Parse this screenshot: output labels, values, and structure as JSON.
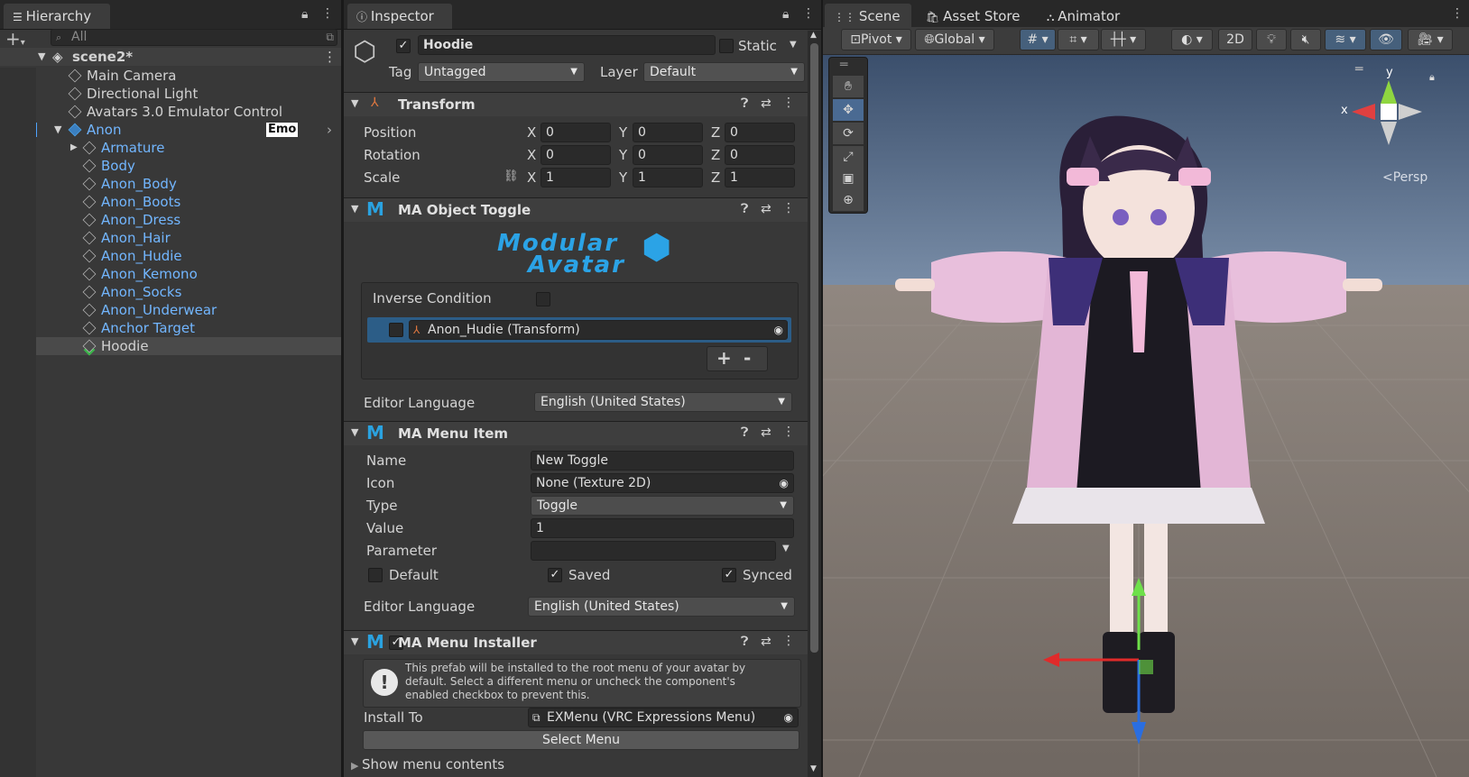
{
  "hierarchy": {
    "tab_label": "Hierarchy",
    "search_placeholder": "All",
    "scene_name": "scene2*",
    "items": [
      {
        "label": "Main Camera",
        "indent": 1,
        "blue": false
      },
      {
        "label": "Directional Light",
        "indent": 1,
        "blue": false
      },
      {
        "label": "Avatars 3.0 Emulator Control",
        "indent": 1,
        "blue": false
      },
      {
        "label": "Anon",
        "indent": 1,
        "blue": true
      },
      {
        "label": "Armature",
        "indent": 2,
        "blue": true
      },
      {
        "label": "Body",
        "indent": 2,
        "blue": true
      },
      {
        "label": "Anon_Body",
        "indent": 2,
        "blue": true
      },
      {
        "label": "Anon_Boots",
        "indent": 2,
        "blue": true
      },
      {
        "label": "Anon_Dress",
        "indent": 2,
        "blue": true
      },
      {
        "label": "Anon_Hair",
        "indent": 2,
        "blue": true
      },
      {
        "label": "Anon_Hudie",
        "indent": 2,
        "blue": true
      },
      {
        "label": "Anon_Kemono",
        "indent": 2,
        "blue": true
      },
      {
        "label": "Anon_Socks",
        "indent": 2,
        "blue": true
      },
      {
        "label": "Anon_Underwear",
        "indent": 2,
        "blue": true
      },
      {
        "label": "Anchor Target",
        "indent": 2,
        "blue": true
      },
      {
        "label": "Hoodie",
        "indent": 2,
        "blue": false
      }
    ],
    "anon_badge": "Emo"
  },
  "inspector": {
    "tab_label": "Inspector",
    "object_name": "Hoodie",
    "static_label": "Static",
    "tag_label": "Tag",
    "tag_value": "Untagged",
    "layer_label": "Layer",
    "layer_value": "Default",
    "transform": {
      "title": "Transform",
      "position_label": "Position",
      "rotation_label": "Rotation",
      "scale_label": "Scale",
      "axis_x": "X",
      "axis_y": "Y",
      "axis_z": "Z",
      "position": [
        "0",
        "0",
        "0"
      ],
      "rotation": [
        "0",
        "0",
        "0"
      ],
      "scale": [
        "1",
        "1",
        "1"
      ]
    },
    "object_toggle": {
      "title": "MA Object Toggle",
      "logo_line1": "Modular",
      "logo_line2": "Avatar",
      "inverse_label": "Inverse Condition",
      "entry": "Anon_Hudie (Transform)",
      "plus": "+",
      "minus": "-",
      "lang_label": "Editor Language",
      "lang_value": "English (United States)"
    },
    "menu_item": {
      "title": "MA Menu Item",
      "name_label": "Name",
      "name_value": "New Toggle",
      "icon_label": "Icon",
      "icon_value": "None (Texture 2D)",
      "type_label": "Type",
      "type_value": "Toggle",
      "value_label": "Value",
      "value_value": "1",
      "param_label": "Parameter",
      "param_value": "",
      "default_label": "Default",
      "saved_label": "Saved",
      "synced_label": "Synced",
      "lang_label": "Editor Language",
      "lang_value": "English (United States)"
    },
    "menu_installer": {
      "title": "MA Menu Installer",
      "info": "This prefab will be installed to the root menu of your avatar by default. Select a different menu or uncheck the component's enabled checkbox to prevent this.",
      "install_label": "Install To",
      "install_value": "EXMenu (VRC Expressions Menu)",
      "select_button": "Select Menu",
      "show_contents": "Show menu contents"
    }
  },
  "scene": {
    "tabs": [
      "Scene",
      "Asset Store",
      "Animator"
    ],
    "pivot": "Pivot",
    "global": "Global",
    "two_d": "2D",
    "persp": "Persp",
    "gizmo_x": "x",
    "gizmo_y": "y",
    "colors": {
      "sky": "#3d5370",
      "ground": "#77706a",
      "accent": "#2e78d0"
    }
  }
}
